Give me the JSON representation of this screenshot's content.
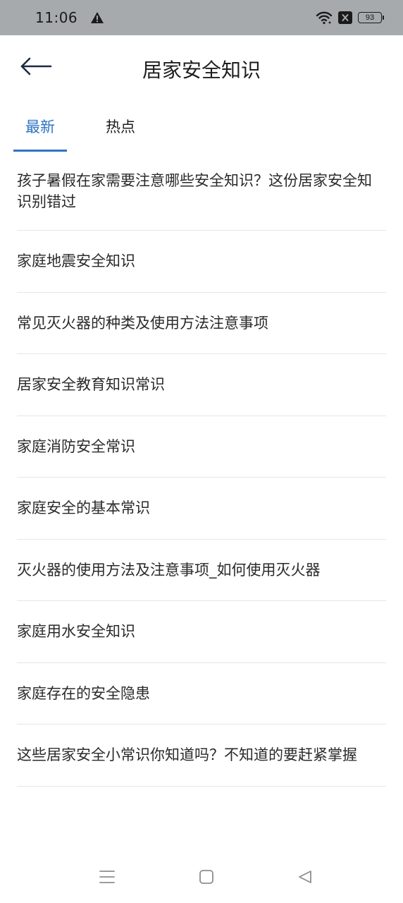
{
  "status_bar": {
    "time": "11:06",
    "battery": "93",
    "icons": [
      "warning-icon",
      "wifi-icon",
      "sim-x-icon",
      "battery-icon"
    ]
  },
  "header": {
    "title": "居家安全知识",
    "back_icon": "arrow-left-icon"
  },
  "tabs": [
    {
      "label": "最新",
      "active": true
    },
    {
      "label": "热点",
      "active": false
    }
  ],
  "articles": [
    "孩子暑假在家需要注意哪些安全知识？这份居家安全知识别错过",
    "家庭地震安全知识",
    "常见灭火器的种类及使用方法注意事项",
    "居家安全教育知识常识",
    "家庭消防安全常识",
    "家庭安全的基本常识",
    "灭火器的使用方法及注意事项_如何使用灭火器",
    "家庭用水安全知识",
    "家庭存在的安全隐患",
    "这些居家安全小常识你知道吗？不知道的要赶紧掌握"
  ],
  "nav_bar": {
    "icons": [
      "menu-icon",
      "home-icon",
      "back-triangle-icon"
    ]
  },
  "colors": {
    "accent": "#2f74c3",
    "status_bar_bg": "#a6aaac",
    "divider": "#e6e6e6"
  }
}
